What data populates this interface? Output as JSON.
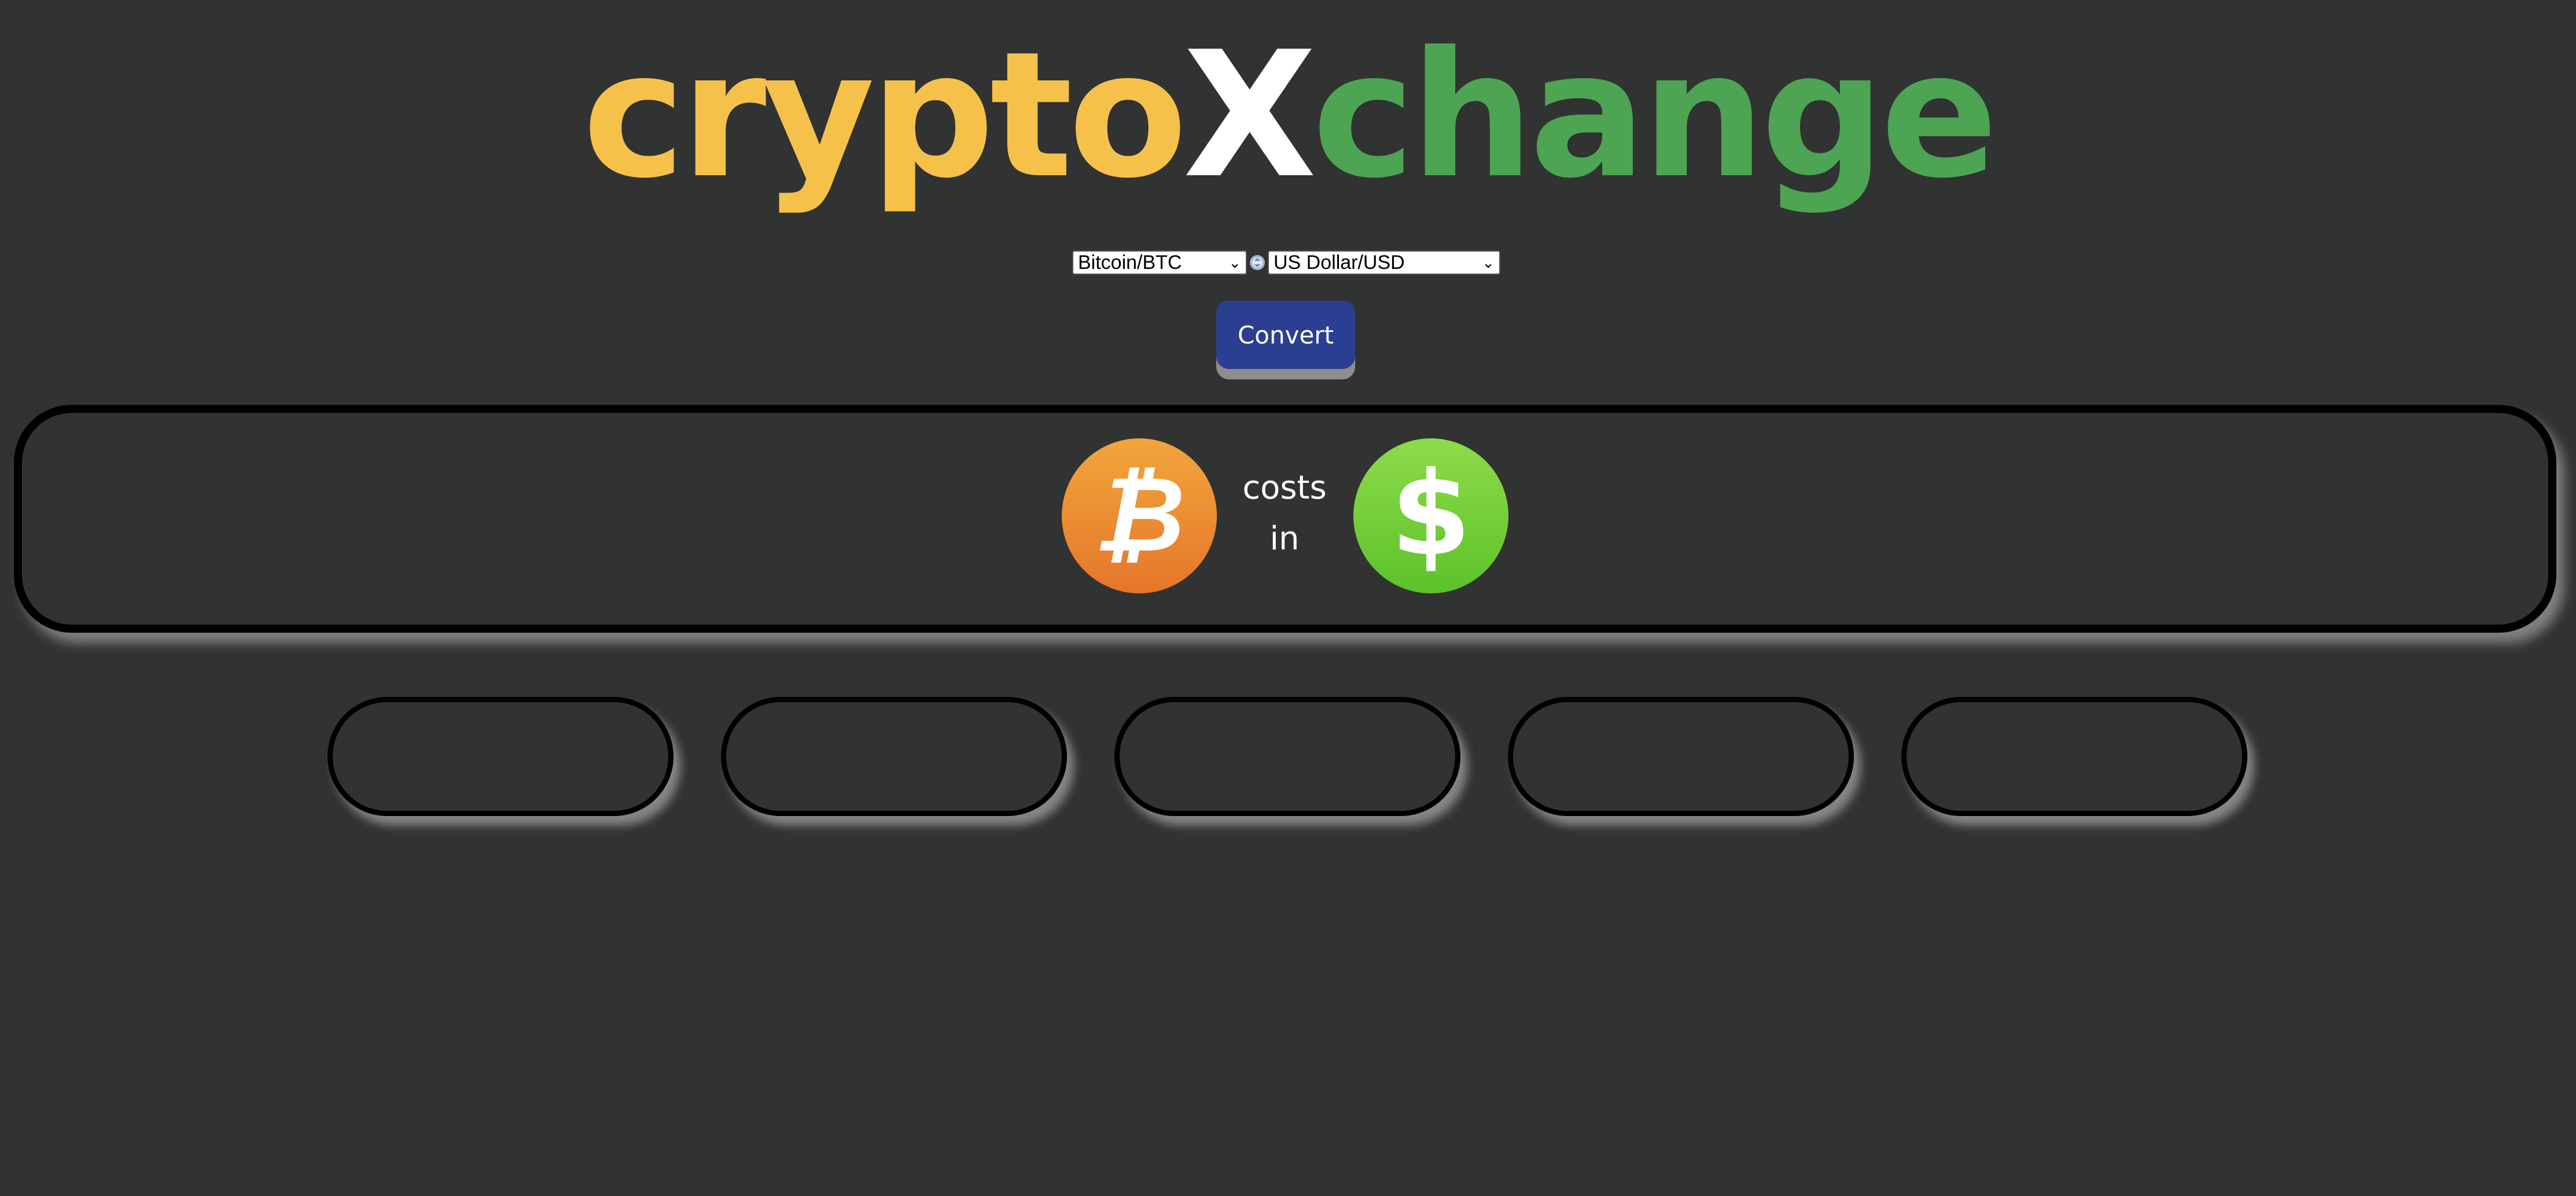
{
  "app": {
    "title_part1": "crypto",
    "title_part2": "X",
    "title_part3": "change",
    "colors": {
      "background": "#313232",
      "crypto": "#f6c14b",
      "x": "#ffffff",
      "change": "#4da452",
      "button": "#2b3f92"
    }
  },
  "converter": {
    "from_selected": "Bitcoin/BTC",
    "to_selected": "US Dollar/USD",
    "swap_icon": "swap-icon",
    "convert_label": "Convert"
  },
  "result": {
    "from_icon": "bitcoin-icon",
    "to_icon": "dollar-icon",
    "text_line1": "costs",
    "text_line2": "in"
  },
  "history": {
    "items": [
      "",
      "",
      "",
      "",
      ""
    ]
  }
}
